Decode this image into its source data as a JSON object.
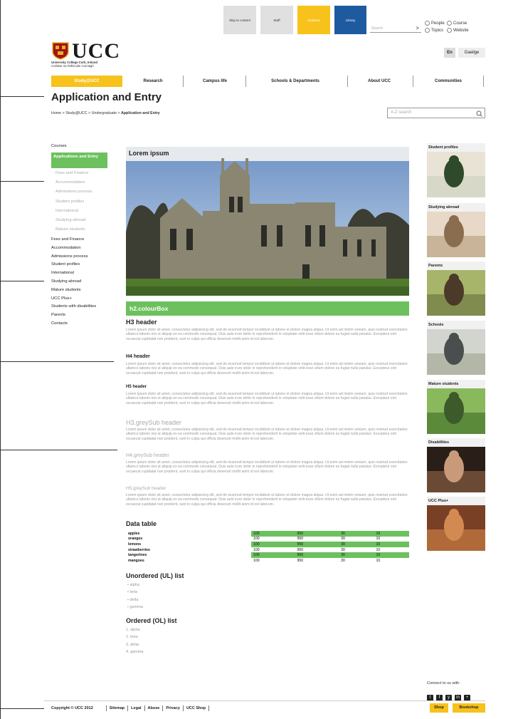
{
  "top_links": {
    "skip": "Skip to content",
    "staff": "Staff",
    "students": "Students",
    "library": "Library"
  },
  "search": {
    "placeholder": "Search",
    "go": ">"
  },
  "radios": [
    "People",
    "Course",
    "Topics",
    "Website"
  ],
  "logo": {
    "name": "UCC",
    "line1": "University College Cork, Ireland",
    "line2": "Coláiste na hOllscoile Corcaigh"
  },
  "lang": {
    "en": "En",
    "ga": "Gaeilge"
  },
  "nav": [
    "Study@UCC",
    "Research",
    "Campus life",
    "Schools & Departments",
    "About UCC",
    "Communities"
  ],
  "page_title": "Application and Entry",
  "breadcrumb": {
    "trail": "Home > Study@UCC > Undergraduate > ",
    "current": "Application and Entry"
  },
  "az": {
    "placeholder": "A-Z search"
  },
  "left_nav": {
    "courses": "Courses",
    "active": "Applications and Entry",
    "sub": [
      "Fees and Finance",
      "Accommodation",
      "Admissions process",
      "Student profiles",
      "International",
      "Studying abroad",
      "Mature students"
    ],
    "main": [
      "Fees and Finance",
      "Accommodation",
      "Admissions process",
      "Student profiles",
      "International",
      "Studying abroad",
      "Mature students",
      "UCC Plus+",
      "Students with disabilities",
      "Parents",
      "Contacts"
    ]
  },
  "hero": {
    "caption": "Lorem ipsum"
  },
  "content": {
    "colourbox": "h2.colourBox",
    "h3": "H3 header",
    "h4": "H4 header",
    "h5": "H5 header",
    "h3grey": "H3.greySub header",
    "h4grey": "H4.greySub header",
    "h5grey": "H5.greySub header",
    "lorem": "Lorem ipsum dolor sit amet, consectetur adipisicing elit, sed do eiusmod tempor incididunt ut labore et dolore magna aliqua. Ut enim ad minim veniam, quis nostrud exercitation ullamco laboris nisi ut aliquip ex ea commodo consequat. Duis aute irure dolor in reprehenderit in voluptate velit esse cillum dolore eu fugiat nulla pariatur. Excepteur sint occaecat cupidatat non proident, sunt in culpa qui officia deserunt mollit anim id est laborum.",
    "data_table_title": "Data table",
    "table": [
      [
        "apples",
        "100",
        "950",
        "30",
        "10"
      ],
      [
        "oranges",
        "100",
        "950",
        "30",
        "10"
      ],
      [
        "lemons",
        "100",
        "950",
        "30",
        "10"
      ],
      [
        "strawberries",
        "100",
        "950",
        "30",
        "10"
      ],
      [
        "tangerines",
        "100",
        "950",
        "30",
        "10"
      ],
      [
        "mangoes",
        "100",
        "950",
        "30",
        "10"
      ]
    ],
    "ul_title": "Unordered (UL) list",
    "ul": [
      "alpha",
      "beta",
      "delta",
      "gamma"
    ],
    "ol_title": "Ordered (OL) list",
    "ol": [
      "alpha",
      "beta",
      "delta",
      "gamma"
    ]
  },
  "right_thumbs": [
    "Student profiles",
    "Studying abroad",
    "Parents",
    "Schools",
    "Mature students",
    "Disabilities",
    "UCC Plus+"
  ],
  "connect": "Connect to us with:",
  "footer": {
    "copyright": "Copyright © UCC 2012",
    "links": [
      "Sitemap",
      "Legal",
      "Abuse",
      "Privacy",
      "UCC Shop"
    ],
    "shop": "Shop",
    "bookshop": "Bookshop"
  },
  "colors": {
    "accent_yellow": "#f7c21c",
    "library_blue": "#1e5aa0",
    "green": "#6cc15e",
    "grey_btn": "#e0e0e0"
  }
}
